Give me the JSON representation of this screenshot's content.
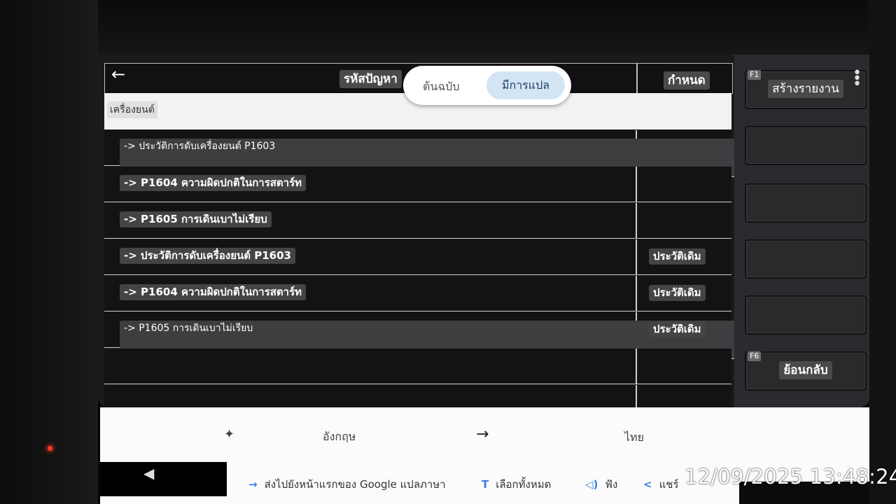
{
  "header": {
    "back_icon": "arrow-left-icon",
    "title": "รหัสปัญหา",
    "definition": "กำหนด"
  },
  "translate_toggle": {
    "original": "ต้นฉบับ",
    "translated": "มีการแปล"
  },
  "section": {
    "label": "เครื่องยนต์"
  },
  "rows": [
    {
      "dtc": "-> ประวัติการดับเครื่องยนต์ P1603",
      "status": ""
    },
    {
      "dtc": "-> P1604 ความผิดปกติในการสตาร์ท",
      "status": ""
    },
    {
      "dtc": "-> P1605 การเดินเบาไม่เรียบ",
      "status": ""
    },
    {
      "dtc": "-> ประวัติการดับเครื่องยนต์ P1603",
      "status": "ประวัติเดิม"
    },
    {
      "dtc": "-> P1604 ความผิดปกติในการสตาร์ท",
      "status": "ประวัติเดิม"
    },
    {
      "dtc": "-> P1605 การเดินเบาไม่เรียบ",
      "status": "ประวัติเดิม"
    },
    {
      "dtc": "",
      "status": ""
    },
    {
      "dtc": "",
      "status": ""
    }
  ],
  "side_panel": {
    "f1_key": "F1",
    "f1_label": "สร้างรายงาน",
    "f6_key": "F6",
    "f6_label": "ย้อนกลับ",
    "menu_icon": "more-vertical-icon"
  },
  "translate_bar": {
    "source_lang": "อังกฤษ",
    "target_lang": "ไทย",
    "sparkle_icon": "sparkle-icon",
    "swap_icon": "arrow-right-icon",
    "actions": {
      "send": "ส่งไปยังหน้าแรกของ Google แปลภาษา",
      "select_all": "เลือกทั้งหมด",
      "listen": "ฟัง",
      "share": "แชร์"
    }
  },
  "timestamp": "12/09/2025 13:48:24",
  "colors": {
    "accent": "#3b7de0",
    "toggle_active": "#d3e5f4",
    "led": "#ff3a2a"
  }
}
